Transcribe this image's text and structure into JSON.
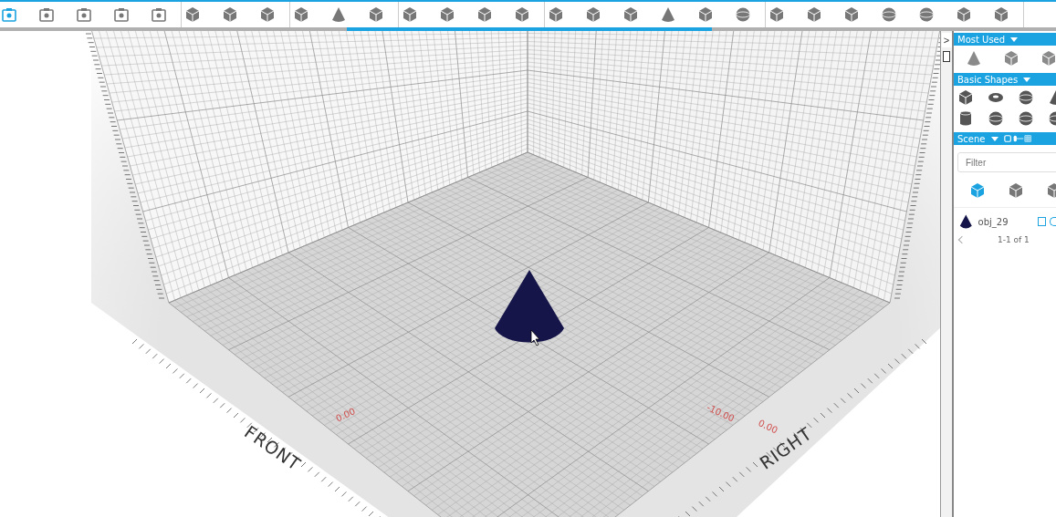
{
  "toolbar": {
    "groups": [
      {
        "tools": [
          {
            "kind": "camera",
            "selected": true
          },
          {
            "kind": "camera",
            "selected": false
          },
          {
            "kind": "camera",
            "selected": false
          },
          {
            "kind": "camera",
            "selected": false
          },
          {
            "kind": "camera",
            "selected": false
          }
        ]
      },
      {
        "tools": [
          {
            "kind": "cube",
            "selected": false
          },
          {
            "kind": "cube",
            "selected": false
          },
          {
            "kind": "cube",
            "selected": false
          }
        ]
      },
      {
        "tools": [
          {
            "kind": "cube",
            "selected": false
          },
          {
            "kind": "cone",
            "selected": false
          },
          {
            "kind": "cube",
            "selected": false
          }
        ]
      },
      {
        "tools": [
          {
            "kind": "cube",
            "selected": false
          },
          {
            "kind": "cube",
            "selected": false
          },
          {
            "kind": "cube",
            "selected": false
          },
          {
            "kind": "cube",
            "selected": false
          }
        ]
      },
      {
        "tools": [
          {
            "kind": "cube",
            "selected": false
          },
          {
            "kind": "cube",
            "selected": false
          },
          {
            "kind": "cube",
            "selected": false
          },
          {
            "kind": "cone",
            "selected": false
          },
          {
            "kind": "cube",
            "selected": false
          },
          {
            "kind": "sphere",
            "selected": false
          }
        ]
      },
      {
        "tools": [
          {
            "kind": "cube",
            "selected": false
          },
          {
            "kind": "cube",
            "selected": false
          },
          {
            "kind": "cube",
            "selected": false
          },
          {
            "kind": "sphere",
            "selected": false
          },
          {
            "kind": "sphere",
            "selected": false
          },
          {
            "kind": "cube",
            "selected": false
          },
          {
            "kind": "cube",
            "selected": false
          }
        ]
      }
    ]
  },
  "viewport": {
    "axis_labels": [
      {
        "text": "FRONT",
        "kind": "front"
      },
      {
        "text": "RIGHT",
        "kind": "right"
      }
    ],
    "ruler_labels": [
      {
        "text": "0.00",
        "kind": "front"
      },
      {
        "text": "-10.00",
        "kind": "right-far"
      },
      {
        "text": "0.00",
        "kind": "right"
      }
    ],
    "object": {
      "kind": "cone",
      "color": "#15154a"
    }
  },
  "sidebar": {
    "collapse_button": ">",
    "most_used": {
      "title": "Most Used",
      "shapes": [
        {
          "kind": "cone"
        },
        {
          "kind": "cube"
        },
        {
          "kind": "cube"
        }
      ]
    },
    "basic_shapes": {
      "title": "Basic Shapes",
      "shapes": [
        {
          "kind": "cube"
        },
        {
          "kind": "torus"
        },
        {
          "kind": "sphere"
        },
        {
          "kind": "cone"
        },
        {
          "kind": "cylinder"
        },
        {
          "kind": "sphere"
        },
        {
          "kind": "sphere"
        },
        {
          "kind": "sphere"
        }
      ]
    },
    "scene": {
      "title": "Scene",
      "filter": {
        "placeholder": "Filter"
      },
      "views": [
        {
          "kind": "cube",
          "selected": true
        },
        {
          "kind": "cube",
          "selected": false
        },
        {
          "kind": "cube",
          "selected": false
        }
      ],
      "objects": [
        {
          "name": "obj_29",
          "color": "#15154a",
          "checked": false
        }
      ],
      "pagination": "1-1 of 1"
    }
  }
}
